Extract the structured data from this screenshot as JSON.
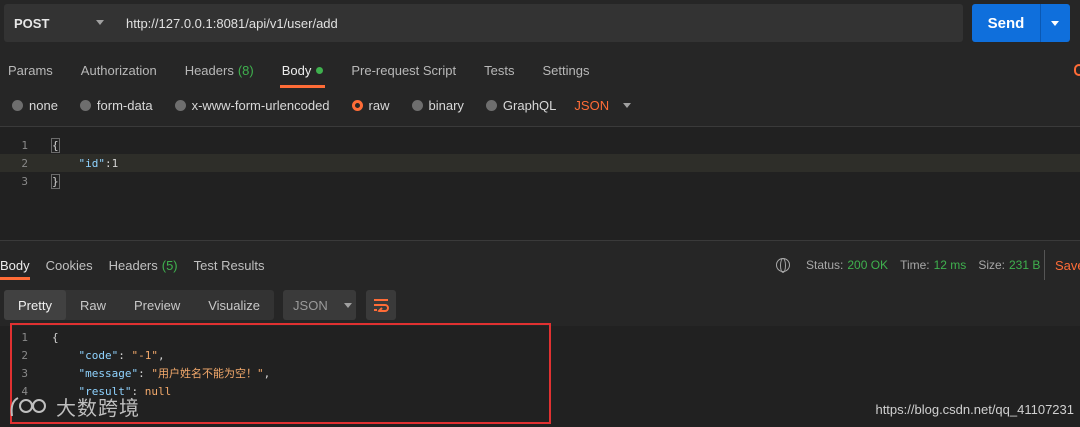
{
  "request": {
    "method": "POST",
    "url": "http://127.0.0.1:8081/api/v1/user/add",
    "send_label": "Send"
  },
  "request_tabs": [
    {
      "label": "Params"
    },
    {
      "label": "Authorization"
    },
    {
      "label": "Headers",
      "count": "(8)"
    },
    {
      "label": "Body",
      "active": true,
      "dot": true
    },
    {
      "label": "Pre-request Script"
    },
    {
      "label": "Tests"
    },
    {
      "label": "Settings"
    }
  ],
  "body_types": [
    {
      "label": "none"
    },
    {
      "label": "form-data"
    },
    {
      "label": "x-www-form-urlencoded"
    },
    {
      "label": "raw",
      "selected": true
    },
    {
      "label": "binary"
    },
    {
      "label": "GraphQL"
    }
  ],
  "body_format": "JSON",
  "request_body": {
    "line_numbers": [
      "1",
      "2",
      "3"
    ],
    "open_brace": "{",
    "key": "\"id\"",
    "colon": ":",
    "value": "1",
    "close_brace": "}"
  },
  "response_tabs": [
    {
      "label": "Body",
      "active": true
    },
    {
      "label": "Cookies"
    },
    {
      "label": "Headers",
      "count": "(5)"
    },
    {
      "label": "Test Results"
    }
  ],
  "response_stats": {
    "status_label": "Status:",
    "status_value": "200 OK",
    "time_label": "Time:",
    "time_value": "12 ms",
    "size_label": "Size:",
    "size_value": "231 B",
    "save_label": "Save"
  },
  "view_modes": [
    {
      "label": "Pretty",
      "active": true
    },
    {
      "label": "Raw"
    },
    {
      "label": "Preview"
    },
    {
      "label": "Visualize"
    }
  ],
  "response_format": "JSON",
  "response_body": {
    "line_numbers": [
      "1",
      "2",
      "3",
      "4"
    ],
    "open_brace": "{",
    "code_key": "\"code\"",
    "code_value": "\"-1\"",
    "message_key": "\"message\"",
    "message_value": "\"用户姓名不能为空！\"",
    "result_key": "\"result\"",
    "result_value": "null"
  },
  "watermark": {
    "brand_text": "大数跨境",
    "url_text": "https://blog.csdn.net/qq_41107231"
  },
  "colors": {
    "accent": "#ff6c37",
    "send_button": "#0f6fdc",
    "success": "#3fb14e",
    "highlight_box": "#e03131"
  }
}
